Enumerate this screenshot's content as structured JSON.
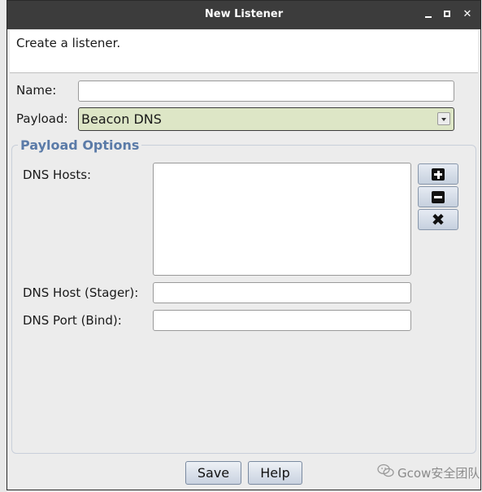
{
  "window": {
    "title": "New Listener",
    "controls": {
      "minimize": "_",
      "maximize": "□",
      "close": "✕"
    }
  },
  "description": "Create a listener.",
  "form": {
    "name": {
      "label": "Name:",
      "value": "",
      "placeholder": ""
    },
    "payload": {
      "label": "Payload:",
      "selected": "Beacon DNS"
    }
  },
  "payload_options": {
    "title": "Payload Options",
    "dns_hosts": {
      "label": "DNS Hosts:",
      "items": []
    },
    "dns_host_stager": {
      "label": "DNS Host (Stager):",
      "value": ""
    },
    "dns_port_bind": {
      "label": "DNS Port (Bind):",
      "value": ""
    },
    "list_buttons": {
      "add_icon": "plus-square-icon",
      "remove_icon": "minus-square-icon",
      "clear_icon": "x-icon"
    }
  },
  "buttons": {
    "save": "Save",
    "help": "Help"
  },
  "watermark": {
    "text": "Gcow安全团队",
    "icon": "wechat-icon"
  },
  "colors": {
    "titlebar": "#3c3c3c",
    "combo_bg": "#dde6c6",
    "group_title": "#5b7ba8",
    "button_top": "#edf1f6",
    "button_bottom": "#c9d2e0"
  }
}
